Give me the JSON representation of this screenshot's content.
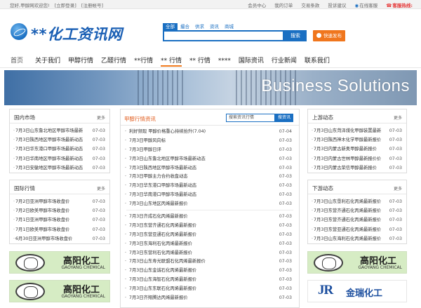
{
  "topbar": {
    "welcome": "您好,甲醇网欢迎您!",
    "login": "[立即登录]",
    "register": "[注册帐号]",
    "links": [
      "会员中心",
      "我的订单",
      "交易条款",
      "投诉建议"
    ],
    "online": "在线客服",
    "hotline": "客服热线:"
  },
  "logo": {
    "text": "**化工资讯网"
  },
  "search": {
    "tabs": [
      "全部",
      "撮合",
      "供求",
      "资讯",
      "商城"
    ],
    "active_tab": 0,
    "value": "",
    "button": "搜索"
  },
  "publish_button": "快速发布",
  "nav": {
    "items": [
      "首页",
      "关于我们",
      "甲醇行情",
      "乙醛行情",
      "**行情",
      "** 行情",
      "** 行情",
      "****",
      "国际资讯",
      "行业新闻",
      "联系我们"
    ],
    "active_index": 5
  },
  "banner": {
    "title": "Business Solutions"
  },
  "left": {
    "domestic": {
      "title": "国内市场",
      "more": "更多",
      "items": [
        {
          "t": "7月3日山东鲁北地区甲醇市场最新",
          "d": "07-03"
        },
        {
          "t": "7月3日陕西地区甲醇市场最新动态",
          "d": "07-03"
        },
        {
          "t": "7月3日华东港口甲醇市场最新动态",
          "d": "07-03"
        },
        {
          "t": "7月3日华南地区甲醇市场最新动态",
          "d": "07-03"
        },
        {
          "t": "7月3日安徽地区甲醇市场最新动态",
          "d": "07-03"
        }
      ]
    },
    "international": {
      "title": "国际行情",
      "more": "更多",
      "items": [
        {
          "t": "7月2日亚洲甲醇市场收盘价",
          "d": "07-03"
        },
        {
          "t": "7月2日欧美甲醇市场收盘价",
          "d": "07-03"
        },
        {
          "t": "7月1日亚洲甲醇市场收盘价",
          "d": "07-03"
        },
        {
          "t": "7月1日欧美甲醇市场收盘价",
          "d": "07-03"
        },
        {
          "t": "6月30日亚洲甲醇市场收盘价",
          "d": "07-03"
        }
      ]
    },
    "ad": {
      "cn": "高阳化工",
      "en": "GAOYANG CHEMICAL"
    }
  },
  "middle": {
    "title": "甲醇行情资讯",
    "search_placeholder": "搜索资讯行情",
    "search_button": "搜资讯",
    "group1": [
      {
        "t": "利好频现 甲醇价格重心持续抬升(7.04)",
        "d": "07-04"
      },
      {
        "t": "7月3日甲醇风向标",
        "d": "07-03"
      },
      {
        "t": "7月3日甲醇日评",
        "d": "07-03"
      },
      {
        "t": "7月3日山东鲁北地区甲醇市场最新动态",
        "d": "07-03"
      },
      {
        "t": "7月3日陕西地区甲醇市场最新动态",
        "d": "07-03"
      },
      {
        "t": "7月3日甲醇主力合约收盘动态",
        "d": "07-03"
      },
      {
        "t": "7月3日华东港口甲醇市场最新动态",
        "d": "07-03"
      },
      {
        "t": "7月3日华南港口甲醇市场最新动态",
        "d": "07-03"
      },
      {
        "t": "7月3日山东地区丙烯最新报价",
        "d": "07-03"
      }
    ],
    "group2": [
      {
        "t": "7月3日齐成石化丙烯最新报价",
        "d": "07-03"
      },
      {
        "t": "7月3日东营齐通石化丙烯最新报价",
        "d": "07-03"
      },
      {
        "t": "7月3日东营亚通石化丙烯最新报价",
        "d": "07-03"
      },
      {
        "t": "7月3日东海利石化丙烯最新报价",
        "d": "07-03"
      },
      {
        "t": "7月3日东营利石化丙烯最新报价",
        "d": "07-03"
      },
      {
        "t": "7月3日山东寿光联盟石化丙烯最新报价",
        "d": "07-03"
      },
      {
        "t": "7月3日山东金诚石化丙烯最新报价",
        "d": "07-03"
      },
      {
        "t": "7月3日山东海智石化丙烯最新报价",
        "d": "07-03"
      },
      {
        "t": "7月3日山东东联石化丙烯最新报价",
        "d": "07-03"
      },
      {
        "t": "7月3日齐翔腾达丙烯最新报价",
        "d": "07-03"
      }
    ]
  },
  "right": {
    "upstream": {
      "title": "上游动态",
      "more": "更多",
      "items": [
        {
          "t": "7月3日山东菏泽煤化甲醇装置最新",
          "d": "07-03"
        },
        {
          "t": "7月3日陕西神木化学甲醇最新报价",
          "d": "07-03"
        },
        {
          "t": "7月3日内蒙古新奥甲醇最新报价",
          "d": "07-03"
        },
        {
          "t": "7月3日内蒙古世林甲醇最新报价价",
          "d": "07-03"
        },
        {
          "t": "7月3日内蒙古荣信甲醇最新报价",
          "d": "07-03"
        }
      ]
    },
    "downstream": {
      "title": "下游动态",
      "more": "更多",
      "items": [
        {
          "t": "7月3日山东垦利石化丙烯最新报价",
          "d": "07-03"
        },
        {
          "t": "7月3日东营齐通石化丙烯最新报价",
          "d": "07-03"
        },
        {
          "t": "7月3日东营齐通石化丙烯最新报价",
          "d": "07-03"
        },
        {
          "t": "7月3日东营亚通石化丙烯最新报价",
          "d": "07-03"
        },
        {
          "t": "7月3日山东海利石化丙烯最新报价",
          "d": "07-03"
        }
      ]
    },
    "ad1": {
      "cn": "高阳化工",
      "en": "GAOYANG CHEMICAL"
    },
    "ad2": {
      "logo": "JR",
      "cn": "金瑞化工"
    }
  }
}
